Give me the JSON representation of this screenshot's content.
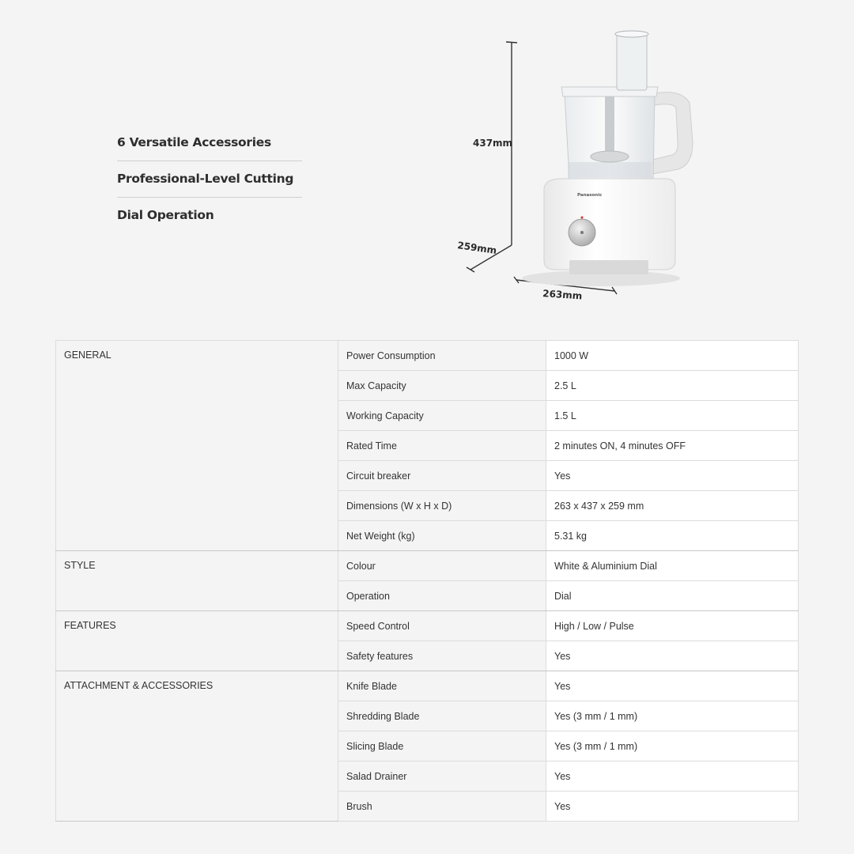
{
  "features": [
    "6 Versatile Accessories",
    "Professional-Level Cutting",
    "Dial Operation"
  ],
  "product": {
    "brand": "Panasonic",
    "dim_height": "437mm",
    "dim_depth": "259mm",
    "dim_width": "263mm"
  },
  "specs": [
    {
      "category": "GENERAL",
      "rows": [
        {
          "label": "Power Consumption",
          "value": "1000 W"
        },
        {
          "label": "Max Capacity",
          "value": "2.5 L"
        },
        {
          "label": "Working Capacity",
          "value": "1.5 L"
        },
        {
          "label": "Rated Time",
          "value": "2 minutes ON, 4 minutes OFF"
        },
        {
          "label": "Circuit breaker",
          "value": "Yes"
        },
        {
          "label": "Dimensions (W x H x D)",
          "value": "263 x 437 x 259 mm"
        },
        {
          "label": "Net Weight (kg)",
          "value": "5.31 kg"
        }
      ]
    },
    {
      "category": "STYLE",
      "rows": [
        {
          "label": "Colour",
          "value": "White & Aluminium Dial"
        },
        {
          "label": "Operation",
          "value": "Dial"
        }
      ]
    },
    {
      "category": "FEATURES",
      "rows": [
        {
          "label": "Speed Control",
          "value": "High / Low / Pulse"
        },
        {
          "label": "Safety features",
          "value": "Yes"
        }
      ]
    },
    {
      "category": "ATTACHMENT & ACCESSORIES",
      "rows": [
        {
          "label": "Knife Blade",
          "value": "Yes"
        },
        {
          "label": "Shredding Blade",
          "value": "Yes (3 mm / 1 mm)"
        },
        {
          "label": "Slicing Blade",
          "value": "Yes (3 mm / 1 mm)"
        },
        {
          "label": "Salad Drainer",
          "value": "Yes"
        },
        {
          "label": "Brush",
          "value": "Yes"
        }
      ]
    }
  ]
}
